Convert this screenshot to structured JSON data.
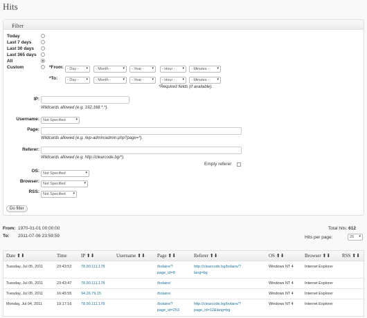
{
  "page": {
    "title": "Hits"
  },
  "filter": {
    "header_label": "Filter",
    "periods": [
      {
        "label": "Today",
        "selected": false
      },
      {
        "label": "Last 7 days",
        "selected": false
      },
      {
        "label": "Last 30 days",
        "selected": false
      },
      {
        "label": "Last 365 days",
        "selected": false
      },
      {
        "label": "All",
        "selected": true
      },
      {
        "label": "Custom",
        "selected": false
      }
    ],
    "from_label": "*From:",
    "to_label": "*To:",
    "day_placeholder": "- Day -",
    "month_placeholder": "- Month -",
    "year_placeholder": "- Year -",
    "hour_placeholder": "- Hour -",
    "minutes_placeholder": "- Minutes -",
    "required_note": "*Required fields (if available).",
    "ip_label": "IP:",
    "ip_hint": "Wildcards allowed (e.g. 192.168.*.*).",
    "username_label": "Username:",
    "username_value": "Not Specified",
    "page_label": "Page:",
    "page_hint": "Wildcards allowed (e.g. /wp-admin/admin.php?page=*).",
    "referer_label": "Referer:",
    "referer_hint": "Wildcards allowed (e.g. http://clearcode.bg/*).",
    "empty_referer_label": "Empty referer",
    "os_label": "OS:",
    "os_value": "Not Specified",
    "browser_label": "Browser:",
    "browser_value": "Not Specified",
    "rss_label": "RSS:",
    "rss_value": "Not Specified",
    "do_filter_label": "Do filter"
  },
  "summary": {
    "from_label": "From:",
    "from_value": "1970-01-01 00:00:00",
    "to_label": "To:",
    "to_value": "2011-07-06 23:59:59",
    "total_hits_label": "Total hits:",
    "total_hits_value": "612",
    "hits_per_page_label": "Hits per page:",
    "hits_per_page_value": "20"
  },
  "table": {
    "columns": [
      "Date",
      "Time",
      "IP",
      "Username",
      "Page",
      "Referer",
      "OS",
      "Browser",
      "RSS"
    ],
    "sort_glyph": "⬆⬇",
    "rows": [
      {
        "date": "Tuesday, Jul 05, 2011",
        "time": "23:43:52",
        "ip": "78.90.111.178",
        "page1": "/bolaire/?",
        "page2": "page_id=8",
        "ref1": "http://clearcode.bg/bolaire/?",
        "ref2": "lang=bg",
        "os": "Windows NT 4",
        "browser": "Internet Explorer"
      },
      {
        "date": "Tuesday, Jul 05, 2011",
        "time": "23:43:47",
        "ip": "78.90.111.178",
        "page1": "/bolaire/",
        "page2": "",
        "ref1": "",
        "ref2": "",
        "os": "Windows NT 4",
        "browser": "Internet Explorer"
      },
      {
        "date": "Tuesday, Jul 05, 2011",
        "time": "16:45:55",
        "ip": "94.26.79.15",
        "page1": "/bolaire/",
        "page2": "",
        "ref1": "",
        "ref2": "",
        "os": "Windows NT 4",
        "browser": "Internet Explorer"
      },
      {
        "date": "Monday, Jul 04, 2011",
        "time": "19:17:16",
        "ip": "78.90.111.178",
        "page1": "/bolaire/?",
        "page2": "page_id=253",
        "ref1": "http://clearcode.bg/bolaire/?",
        "ref2": "page_id=12&lang=bg",
        "os": "Windows NT 4",
        "browser": "Internet Explorer"
      }
    ]
  }
}
